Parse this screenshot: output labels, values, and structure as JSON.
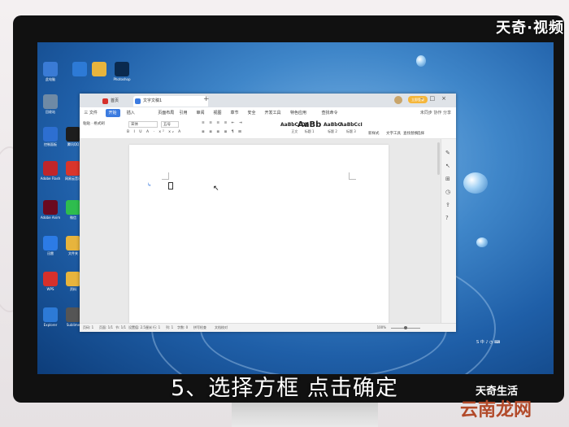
{
  "watermark_top": "天奇·视频",
  "subtitle": "5、选择方框 点击确定",
  "watermark_bottom": "天奇生活",
  "watermark_site": "云南龙网",
  "desktop_icons": [
    {
      "label": "此电脑",
      "color": "#3a7bd5"
    },
    {
      "label": "回收站",
      "color": "#6f8aa5"
    },
    {
      "label": "控制面板",
      "color": "#2d6fd1"
    },
    {
      "label": "腾讯QQ",
      "color": "#1d1d1d"
    },
    {
      "label": "Adobe Flash",
      "color": "#c0262a"
    },
    {
      "label": "网易云音乐",
      "color": "#d9352b"
    },
    {
      "label": "微信",
      "color": "#2ebd4e"
    },
    {
      "label": "Adobe Anim",
      "color": "#6a0a20"
    },
    {
      "label": "迅雷",
      "color": "#2c7be5"
    },
    {
      "label": "文件夹",
      "color": "#e7b43d"
    },
    {
      "label": "WPS",
      "color": "#d6302b"
    },
    {
      "label": "资料",
      "color": "#e7b43d"
    },
    {
      "label": "Photoshop",
      "color": "#0a2a4f"
    },
    {
      "label": "Explorer",
      "color": "#2d7ad6"
    },
    {
      "label": "Sublime",
      "color": "#555555"
    }
  ],
  "app": {
    "tab_home": "首页",
    "tab_doc": "文字文稿1",
    "badge": "立即登录",
    "menus": [
      "三 文件",
      "开始",
      "插入",
      "页面布局",
      "引用",
      "审阅",
      "视图",
      "章节",
      "安全",
      "开发工具",
      "特色应用",
      "查找命令"
    ],
    "menu_active_index": 1,
    "menu_right": "未同步 协作 分享",
    "ribbon_left": "粘贴 · 格式刷",
    "font_name": "宋体",
    "font_size": "五号",
    "styles": [
      {
        "preview": "AaBbCcDd",
        "name": "正文"
      },
      {
        "preview": "AaBb",
        "name": "标题 1"
      },
      {
        "preview": "AaBbC",
        "name": "标题 2"
      },
      {
        "preview": "AaBbCcI",
        "name": "标题 3"
      }
    ],
    "ribbon_right": [
      "新样式",
      "文字工具",
      "查找替换",
      "选择"
    ],
    "status_items": [
      "页码: 1",
      "页面: 1/1",
      "节: 1/1",
      "设置值: 2.5厘米",
      "行: 1",
      "列: 1",
      "字数: 0",
      "拼写检查",
      "文档校对"
    ],
    "zoom": "100%"
  }
}
